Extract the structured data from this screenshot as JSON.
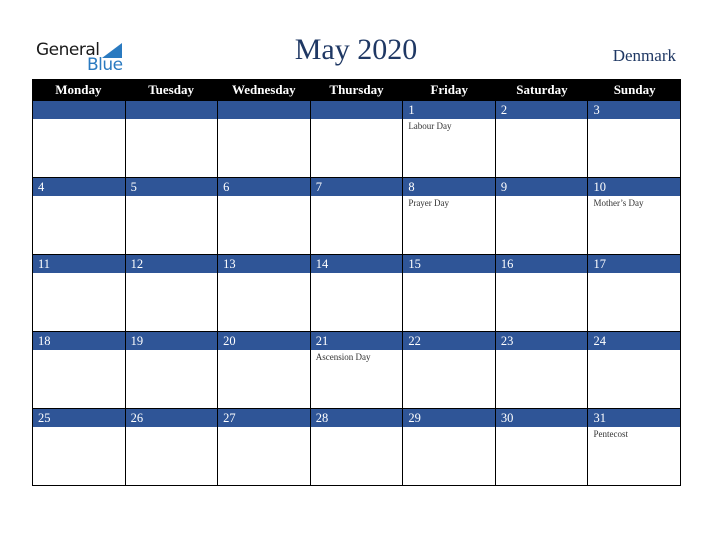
{
  "logo": {
    "line1": "General",
    "line2": "Blue",
    "accent": "#2a7ac0"
  },
  "title": "May 2020",
  "country": "Denmark",
  "colors": {
    "header_bg": "#000000",
    "bar_bg": "#2f5597",
    "title": "#1f3864"
  },
  "weekdays": [
    "Monday",
    "Tuesday",
    "Wednesday",
    "Thursday",
    "Friday",
    "Saturday",
    "Sunday"
  ],
  "weeks": [
    [
      {
        "day": "",
        "event": ""
      },
      {
        "day": "",
        "event": ""
      },
      {
        "day": "",
        "event": ""
      },
      {
        "day": "",
        "event": ""
      },
      {
        "day": "1",
        "event": "Labour Day"
      },
      {
        "day": "2",
        "event": ""
      },
      {
        "day": "3",
        "event": ""
      }
    ],
    [
      {
        "day": "4",
        "event": ""
      },
      {
        "day": "5",
        "event": ""
      },
      {
        "day": "6",
        "event": ""
      },
      {
        "day": "7",
        "event": ""
      },
      {
        "day": "8",
        "event": "Prayer Day"
      },
      {
        "day": "9",
        "event": ""
      },
      {
        "day": "10",
        "event": "Mother’s Day"
      }
    ],
    [
      {
        "day": "11",
        "event": ""
      },
      {
        "day": "12",
        "event": ""
      },
      {
        "day": "13",
        "event": ""
      },
      {
        "day": "14",
        "event": ""
      },
      {
        "day": "15",
        "event": ""
      },
      {
        "day": "16",
        "event": ""
      },
      {
        "day": "17",
        "event": ""
      }
    ],
    [
      {
        "day": "18",
        "event": ""
      },
      {
        "day": "19",
        "event": ""
      },
      {
        "day": "20",
        "event": ""
      },
      {
        "day": "21",
        "event": "Ascension Day"
      },
      {
        "day": "22",
        "event": ""
      },
      {
        "day": "23",
        "event": ""
      },
      {
        "day": "24",
        "event": ""
      }
    ],
    [
      {
        "day": "25",
        "event": ""
      },
      {
        "day": "26",
        "event": ""
      },
      {
        "day": "27",
        "event": ""
      },
      {
        "day": "28",
        "event": ""
      },
      {
        "day": "29",
        "event": ""
      },
      {
        "day": "30",
        "event": ""
      },
      {
        "day": "31",
        "event": "Pentecost"
      }
    ]
  ]
}
